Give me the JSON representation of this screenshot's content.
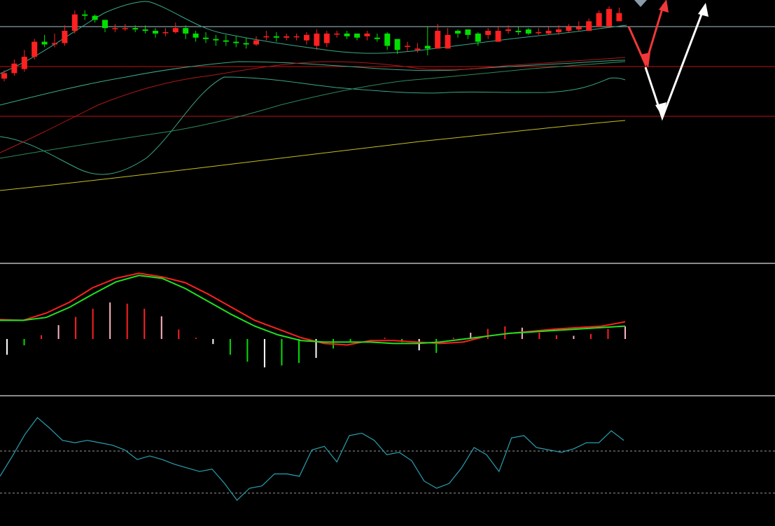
{
  "colors": {
    "background": "#000000",
    "up": "#ff2020",
    "down": "#00e000",
    "bb_band": "#3aa88a",
    "ma_fast": "#b01818",
    "ma_mid": "#2c8a5c",
    "ma_long": "#c8c020",
    "macd_dif": "#ff2020",
    "macd_dea": "#20e020",
    "rsi_line": "#2aa0b0",
    "pane_divider": "#8a8a8a",
    "hline_price": "#a8c0c8",
    "hline_support": "#c01010",
    "arrow_red": "#f03838",
    "arrow_white": "#ffffff"
  },
  "chart_data": [
    {
      "type": "candlestick",
      "pane": "price",
      "ylim": [
        0,
        100
      ],
      "x": [
        0,
        1,
        2,
        3,
        4,
        5,
        6,
        7,
        8,
        9,
        10,
        11,
        12,
        13,
        14,
        15,
        16,
        17,
        18,
        19,
        20,
        21,
        22,
        23,
        24,
        25,
        26,
        27,
        28,
        29,
        30,
        31,
        32,
        33,
        34,
        35,
        36,
        37,
        38,
        39,
        40,
        41,
        42,
        43,
        44,
        45,
        46,
        47,
        48,
        49,
        50,
        51,
        52,
        53,
        54,
        55,
        56,
        57,
        58,
        59,
        60,
        61,
        62,
        63,
        64,
        65,
        66,
        67,
        68,
        69,
        70,
        71,
        72,
        73,
        74,
        75,
        76,
        77,
        78,
        79,
        80
      ],
      "open": [
        45,
        49,
        52,
        61,
        72,
        70,
        71,
        80,
        92,
        91,
        88,
        82,
        82,
        82,
        81,
        80,
        79,
        79,
        82,
        78,
        75,
        74,
        73,
        72,
        71,
        70,
        76,
        76,
        75,
        76,
        73,
        69,
        71,
        78,
        78,
        78,
        76,
        75,
        78,
        74,
        69,
        66,
        69,
        67,
        67,
        80,
        81,
        78,
        77,
        72,
        80,
        80,
        81,
        79,
        78,
        79,
        80,
        81,
        80,
        83,
        83,
        87,
        93,
        96
      ],
      "close": [
        49,
        56,
        61,
        72,
        70,
        71,
        80,
        92,
        91,
        88,
        82,
        82,
        82,
        81,
        80,
        78,
        79,
        82,
        78,
        75,
        74,
        73,
        72,
        71,
        70,
        73,
        76,
        75,
        76,
        76,
        77,
        78,
        78,
        78,
        76,
        75,
        78,
        74,
        69,
        66,
        69,
        67,
        67,
        80,
        77,
        78,
        77,
        72,
        80,
        80,
        81,
        79,
        78,
        79,
        80,
        81,
        83,
        83,
        87,
        93,
        96,
        93
      ],
      "high": [
        51,
        59,
        66,
        74,
        77,
        78,
        84,
        95,
        95,
        92,
        86,
        85,
        85,
        84,
        84,
        82,
        82,
        86,
        84,
        80,
        79,
        77,
        77,
        76,
        75,
        76,
        80,
        79,
        78,
        78,
        79,
        81,
        80,
        80,
        80,
        78,
        80,
        78,
        79,
        72,
        72,
        71,
        83,
        85,
        82,
        81,
        81,
        79,
        82,
        83,
        84,
        83,
        82,
        82,
        83,
        84,
        85,
        87,
        89,
        95,
        98,
        97
      ],
      "low": [
        43,
        47,
        50,
        59,
        68,
        68,
        69,
        78,
        88,
        86,
        79,
        79,
        80,
        79,
        78,
        75,
        76,
        78,
        74,
        72,
        71,
        69,
        69,
        68,
        67,
        69,
        73,
        72,
        73,
        73,
        70,
        66,
        68,
        75,
        74,
        73,
        73,
        72,
        66,
        63,
        65,
        64,
        62,
        74,
        74,
        75,
        74,
        69,
        74,
        76,
        78,
        77,
        77,
        77,
        77,
        77,
        79,
        80,
        81,
        85,
        87,
        88
      ]
    },
    {
      "type": "line",
      "pane": "macd",
      "series": [
        {
          "values": [
            0.31,
            0.3,
            0.4,
            0.55,
            0.75,
            0.88,
            0.95,
            0.9,
            0.82,
            0.66,
            0.48,
            0.3,
            0.18,
            0.06,
            -0.02,
            -0.04,
            0.02,
            0.02,
            0.0,
            -0.02,
            0.0,
            0.08,
            0.12,
            0.15,
            0.18,
            0.2,
            0.22,
            0.28
          ]
        },
        {
          "values": [
            0.3,
            0.3,
            0.34,
            0.48,
            0.66,
            0.83,
            0.92,
            0.88,
            0.74,
            0.56,
            0.38,
            0.22,
            0.1,
            0.02,
            0.0,
            0.0,
            0.0,
            -0.02,
            -0.02,
            0.0,
            0.04,
            0.08,
            0.12,
            0.14,
            0.16,
            0.18,
            0.2,
            0.22
          ]
        }
      ]
    },
    {
      "type": "bar",
      "pane": "macd-histogram",
      "values": [
        -0.25,
        -0.1,
        0.06,
        0.22,
        0.35,
        0.48,
        0.58,
        0.56,
        0.48,
        0.36,
        0.15,
        0.02,
        -0.08,
        -0.25,
        -0.36,
        -0.45,
        -0.42,
        -0.38,
        -0.3,
        -0.15,
        -0.04,
        0.0,
        0.02,
        -0.05,
        -0.18,
        -0.22,
        0.02,
        0.1,
        0.16,
        0.2,
        0.18,
        0.1,
        0.06,
        0.05,
        0.08,
        0.16,
        0.2
      ],
      "ylim": [
        -0.5,
        1.0
      ]
    },
    {
      "type": "line",
      "pane": "oscillator",
      "ylim": [
        0,
        100
      ],
      "reference_lines": [
        70,
        30
      ],
      "values": [
        38,
        55,
        73,
        87,
        78,
        68,
        66,
        68,
        66,
        64,
        60,
        52,
        55,
        52,
        48,
        45,
        42,
        44,
        32,
        18,
        28,
        30,
        40,
        40,
        38,
        60,
        63,
        50,
        72,
        74,
        68,
        56,
        58,
        51,
        34,
        28,
        32,
        45,
        62,
        56,
        42,
        70,
        72,
        62,
        60,
        58,
        61,
        66,
        66,
        76,
        68
      ]
    }
  ]
}
